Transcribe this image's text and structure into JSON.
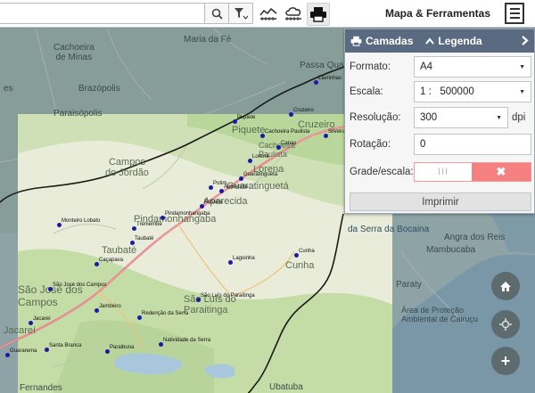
{
  "toolbar": {
    "search_placeholder": "",
    "app_title": "Mapa & Ferramentas",
    "icons": [
      "search-icon",
      "filter-dropdown-icon",
      "profile-chart-icon",
      "cloud-measure-icon",
      "print-icon",
      "menu-icon"
    ]
  },
  "print_panel": {
    "tab_layers": "Camadas",
    "tab_legend": "Legenda",
    "rows": {
      "format": {
        "label": "Formato:",
        "value": "A4"
      },
      "scale": {
        "label": "Escala:",
        "value": "1 :   500000"
      },
      "resolution": {
        "label": "Resolução:",
        "value": "300",
        "unit": "dpi"
      },
      "rotation": {
        "label": "Rotação:",
        "value": "0"
      },
      "grid": {
        "label": "Grade/escala:",
        "toggle_on": "III",
        "toggle_off": "✖"
      }
    },
    "print_button": "Imprimir"
  },
  "map": {
    "labels": {
      "maria_da_fe": "Maria da Fé",
      "cachoeira_minas": "Cachoeira\nde Minas",
      "brazopolis": "Brazópolis",
      "paraisopolis": "Paraisópolis",
      "passa_quatro": "Passa Quatro",
      "es": "es",
      "serra_bocaina": "da Serra da Bocaina",
      "mambucaba": "Mambucaba",
      "angra": "Angra dos Reis",
      "paraty": "Paraty",
      "area_protecao": "Área de Proteção\nAmbiental de Cairuçu",
      "ubatuba": "Ubatuba",
      "fernandes": "Fernandes",
      "campos_jordao": "Campos\ndo Jordão",
      "pindamonhangaba_big": "Pindamonhangaba",
      "taubate_big": "Taubaté",
      "guaratingueta_big": "Guaratinguetá",
      "aparecida_big": "Aparecida",
      "sao_jose_big": "São José dos\nCampos",
      "jacarei_big": "Jacareí",
      "sao_luis_big": "São Luís do\nParaitinga",
      "cunha_big": "Cunha",
      "piquete_big": "Piquete",
      "lorena_big": "Lorena",
      "cruzeiro_big": "Cruzeiro",
      "cachoeira_paulista_big": "Cachoeira\nPaulista"
    },
    "cities": [
      "Lavrinhas",
      "Piquete",
      "Cruzeiro",
      "Cachoeira Paulista",
      "Silveiras",
      "Canas",
      "Lorena",
      "Guaratinguetá",
      "Potim",
      "Aparecida",
      "Roseira",
      "Pindamonhangaba",
      "Monteiro Lobato",
      "Tremembé",
      "Taubaté",
      "Caçapava",
      "Lagoinha",
      "Cunha",
      "São José dos Campos",
      "São Luís do Paraitinga",
      "Jambeiro",
      "Redenção da Serra",
      "Jacareí",
      "Santa Branca",
      "Paraibuna",
      "Natividade da Serra",
      "Guararema"
    ]
  },
  "controls": {
    "home": "home-icon",
    "locate": "locate-icon",
    "zoom_in": "+"
  }
}
